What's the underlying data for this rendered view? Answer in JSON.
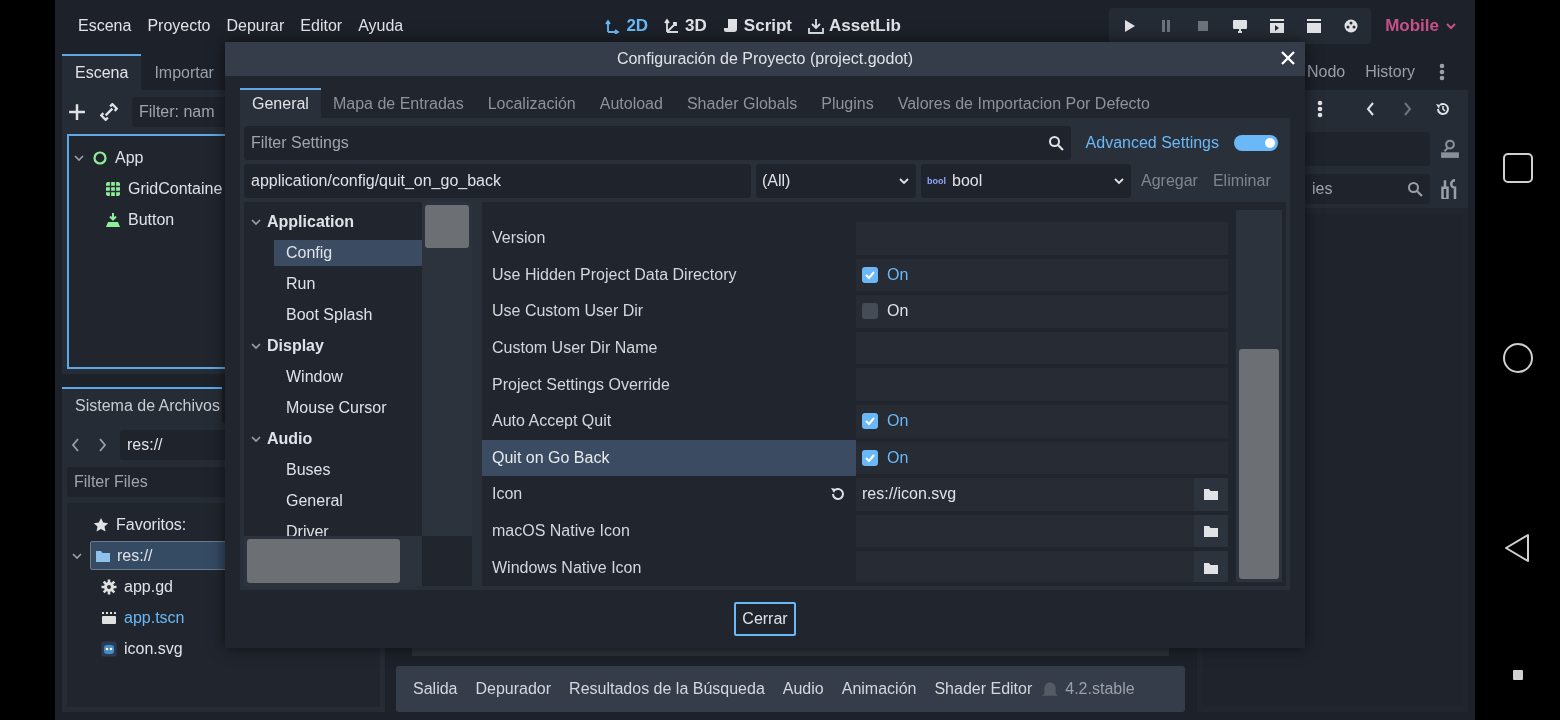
{
  "menu": [
    "Escena",
    "Proyecto",
    "Depurar",
    "Editor",
    "Ayuda"
  ],
  "workspaces": [
    {
      "label": "2D",
      "kind": "twod",
      "selected": true
    },
    {
      "label": "3D",
      "kind": "threed",
      "selected": false
    },
    {
      "label": "Script",
      "kind": "script",
      "selected": false
    },
    {
      "label": "AssetLib",
      "kind": "assetlib",
      "selected": false
    }
  ],
  "renderer": "Mobile",
  "scene_dock": {
    "tabs": [
      {
        "label": "Escena",
        "selected": true
      },
      {
        "label": "Importar",
        "selected": false
      }
    ],
    "filter_placeholder": "Filter: nam",
    "tree": [
      {
        "name": "App",
        "kind": "node",
        "expanded": true,
        "children": [
          {
            "name": "GridContaine",
            "kind": "grid"
          },
          {
            "name": "Button",
            "kind": "button"
          }
        ]
      }
    ]
  },
  "filesystem_dock": {
    "title": "Sistema de Archivos",
    "path": "res://",
    "filter_placeholder": "Filter Files",
    "favorites": "Favoritos:",
    "tree": [
      {
        "name": "res://",
        "kind": "folder",
        "selected": true,
        "current": false,
        "expanded": true,
        "children": [
          {
            "name": "app.gd",
            "kind": "gear",
            "selected": false,
            "current": false
          },
          {
            "name": "app.tscn",
            "kind": "scene",
            "selected": false,
            "current": true
          },
          {
            "name": "icon.svg",
            "kind": "image",
            "selected": false,
            "current": false
          }
        ]
      }
    ]
  },
  "inspector_dock": {
    "tabs": [
      "Nodo",
      "History"
    ],
    "filter_placeholder": "ies"
  },
  "bottom_panel": {
    "tabs": [
      "Salida",
      "Depurador",
      "Resultados de la Búsqueda",
      "Audio",
      "Animación",
      "Shader Editor"
    ],
    "version": "4.2.stable"
  },
  "dialog": {
    "title": "Configuración de Proyecto (project.godot)",
    "tabs": [
      {
        "label": "General",
        "selected": true
      },
      {
        "label": "Mapa de Entradas",
        "selected": false
      },
      {
        "label": "Localización",
        "selected": false
      },
      {
        "label": "Autoload",
        "selected": false
      },
      {
        "label": "Shader Globals",
        "selected": false
      },
      {
        "label": "Plugins",
        "selected": false
      },
      {
        "label": "Valores de Importacion Por Defecto",
        "selected": false
      }
    ],
    "filter_placeholder": "Filter Settings",
    "advanced": {
      "label": "Advanced Settings",
      "on": true
    },
    "property_path": "application/config/quit_on_go_back",
    "type_filter": "(All)",
    "type_icon": "bool",
    "type": "bool",
    "add": {
      "label": "Agregar",
      "disabled": true
    },
    "remove": {
      "label": "Eliminar",
      "disabled": true
    },
    "sections": [
      {
        "name": "Application",
        "expanded": true,
        "children": [
          {
            "name": "Config",
            "selected": true
          },
          {
            "name": "Run",
            "selected": false
          },
          {
            "name": "Boot Splash",
            "selected": false
          }
        ]
      },
      {
        "name": "Display",
        "expanded": true,
        "children": [
          {
            "name": "Window",
            "selected": false
          },
          {
            "name": "Mouse Cursor",
            "selected": false
          }
        ]
      },
      {
        "name": "Audio",
        "expanded": true,
        "children": [
          {
            "name": "Buses",
            "selected": false
          },
          {
            "name": "General",
            "selected": false
          },
          {
            "name": "Driver",
            "selected": false
          }
        ]
      }
    ],
    "properties": [
      {
        "label": "Version",
        "kind": "text",
        "selected": false
      },
      {
        "label": "Use Hidden Project Data Directory",
        "kind": "check",
        "checked": true,
        "text": "On",
        "selected": false
      },
      {
        "label": "Use Custom User Dir",
        "kind": "check",
        "checked": false,
        "text": "On",
        "selected": false
      },
      {
        "label": "Custom User Dir Name",
        "kind": "text",
        "selected": false
      },
      {
        "label": "Project Settings Override",
        "kind": "text",
        "selected": false
      },
      {
        "label": "Auto Accept Quit",
        "kind": "check",
        "checked": true,
        "text": "On",
        "selected": false
      },
      {
        "label": "Quit on Go Back",
        "kind": "check",
        "checked": true,
        "text": "On",
        "selected": true
      },
      {
        "label": "Icon",
        "kind": "file",
        "value": "res://icon.svg",
        "revertable": true,
        "selected": false
      },
      {
        "label": "macOS Native Icon",
        "kind": "file",
        "revertable": false,
        "selected": false
      },
      {
        "label": "Windows Native Icon",
        "kind": "file",
        "revertable": false,
        "selected": false
      }
    ],
    "close": "Cerrar"
  }
}
